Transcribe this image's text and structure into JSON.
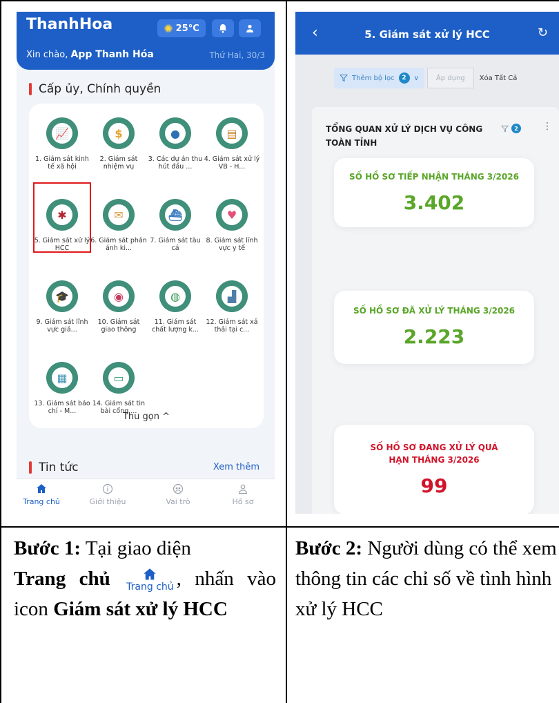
{
  "left_phone": {
    "brand": "ThanhHoa",
    "weather": "25°C",
    "greeting_prefix": "Xin chào,",
    "greeting_name": "App Thanh Hóa",
    "date": "Thứ Hai, 30/3",
    "section1_title": "Cấp ủy, Chính quyền",
    "grid_items": [
      {
        "label": "1. Giám sát kinh tế xã hội",
        "icon": "chart-growth-icon",
        "color": "#5a9e3a"
      },
      {
        "label": "2. Giám sát nhiệm vụ",
        "icon": "money-task-icon",
        "color": "#e6a12a"
      },
      {
        "label": "3. Các dự án thu hút đầu ...",
        "icon": "investment-hand-icon",
        "color": "#2f6fb3"
      },
      {
        "label": "4. Giám sát xử lý VB - H...",
        "icon": "document-stack-icon",
        "color": "#c9852c"
      },
      {
        "label": "5. Giám sát xử lý HCC",
        "icon": "admin-procedure-icon",
        "color": "#b3242f"
      },
      {
        "label": "6. Giám sát phản ánh ki...",
        "icon": "mail-feedback-icon",
        "color": "#e29a4b"
      },
      {
        "label": "7. Giám sát tàu cá",
        "icon": "fishing-boat-icon",
        "color": "#3a7cc1"
      },
      {
        "label": "8. Giám sát lĩnh vực y tế",
        "icon": "heartbeat-icon",
        "color": "#e4507a"
      },
      {
        "label": "9. Giám sát lĩnh vực giá...",
        "icon": "graduation-cap-icon",
        "color": "#2f6b5a"
      },
      {
        "label": "10. Giám sát giao thông",
        "icon": "traffic-camera-icon",
        "color": "#c8375a"
      },
      {
        "label": "11. Giám sát chất lượng k...",
        "icon": "earth-environment-icon",
        "color": "#3f9a55"
      },
      {
        "label": "12. Giám sát xả thải tại c...",
        "icon": "factory-waste-icon",
        "color": "#4f7fa8"
      },
      {
        "label": "13. Giám sát báo chí - M...",
        "icon": "newspaper-icon",
        "color": "#4a9bb7"
      },
      {
        "label": "14. Giám sát tin bài cổng ...",
        "icon": "monitor-news-icon",
        "color": "#2f9c7a"
      }
    ],
    "collapse_label": "Thu gọn ^",
    "section2_title": "Tin tức",
    "see_more": "Xem thêm",
    "nav": [
      "Trang chủ",
      "Giới thiệu",
      "Vai trò",
      "Hồ sơ"
    ]
  },
  "right_phone": {
    "title": "5. Giám sát xử lý HCC",
    "filter_add": "Thêm bộ lọc",
    "filter_count": "2",
    "apply": "Áp dụng",
    "clear_all": "Xóa Tất Cả",
    "overview_title": "TỔNG QUAN XỬ LÝ DỊCH VỤ CÔNG TOÀN TỈNH",
    "overview_filter_count": "2",
    "stats": [
      {
        "label": "SỐ HỒ SƠ TIẾP NHẬN THÁNG 3/2026",
        "value": "3.402",
        "color": "#5aa629"
      },
      {
        "label": "SỐ HỒ SƠ ĐÃ XỬ LÝ THÁNG 3/2026",
        "value": "2.223",
        "color": "#5aa629"
      },
      {
        "label": "SỐ HỒ SƠ ĐANG XỬ LÝ QUÁ HẠN THÁNG 3/2026",
        "value": "99",
        "color": "#d0152b"
      }
    ]
  },
  "steps": {
    "step1_label": "Bước 1:",
    "step1_t1": "Tại giao diện",
    "step1_home": "Trang chủ",
    "step1_home_icon_label": "Trang chủ",
    "step1_t2": ", nhấn vào icon",
    "step1_target": "Giám sát xử lý HCC",
    "step2_label": "Bước 2:",
    "step2_text": "Người dùng có thể xem thông tin các chỉ số về tình hình xử lý HCC"
  },
  "colors": {
    "primary": "#1d5fc6",
    "highlight": "#e0191b",
    "accent_red": "#e53935"
  }
}
